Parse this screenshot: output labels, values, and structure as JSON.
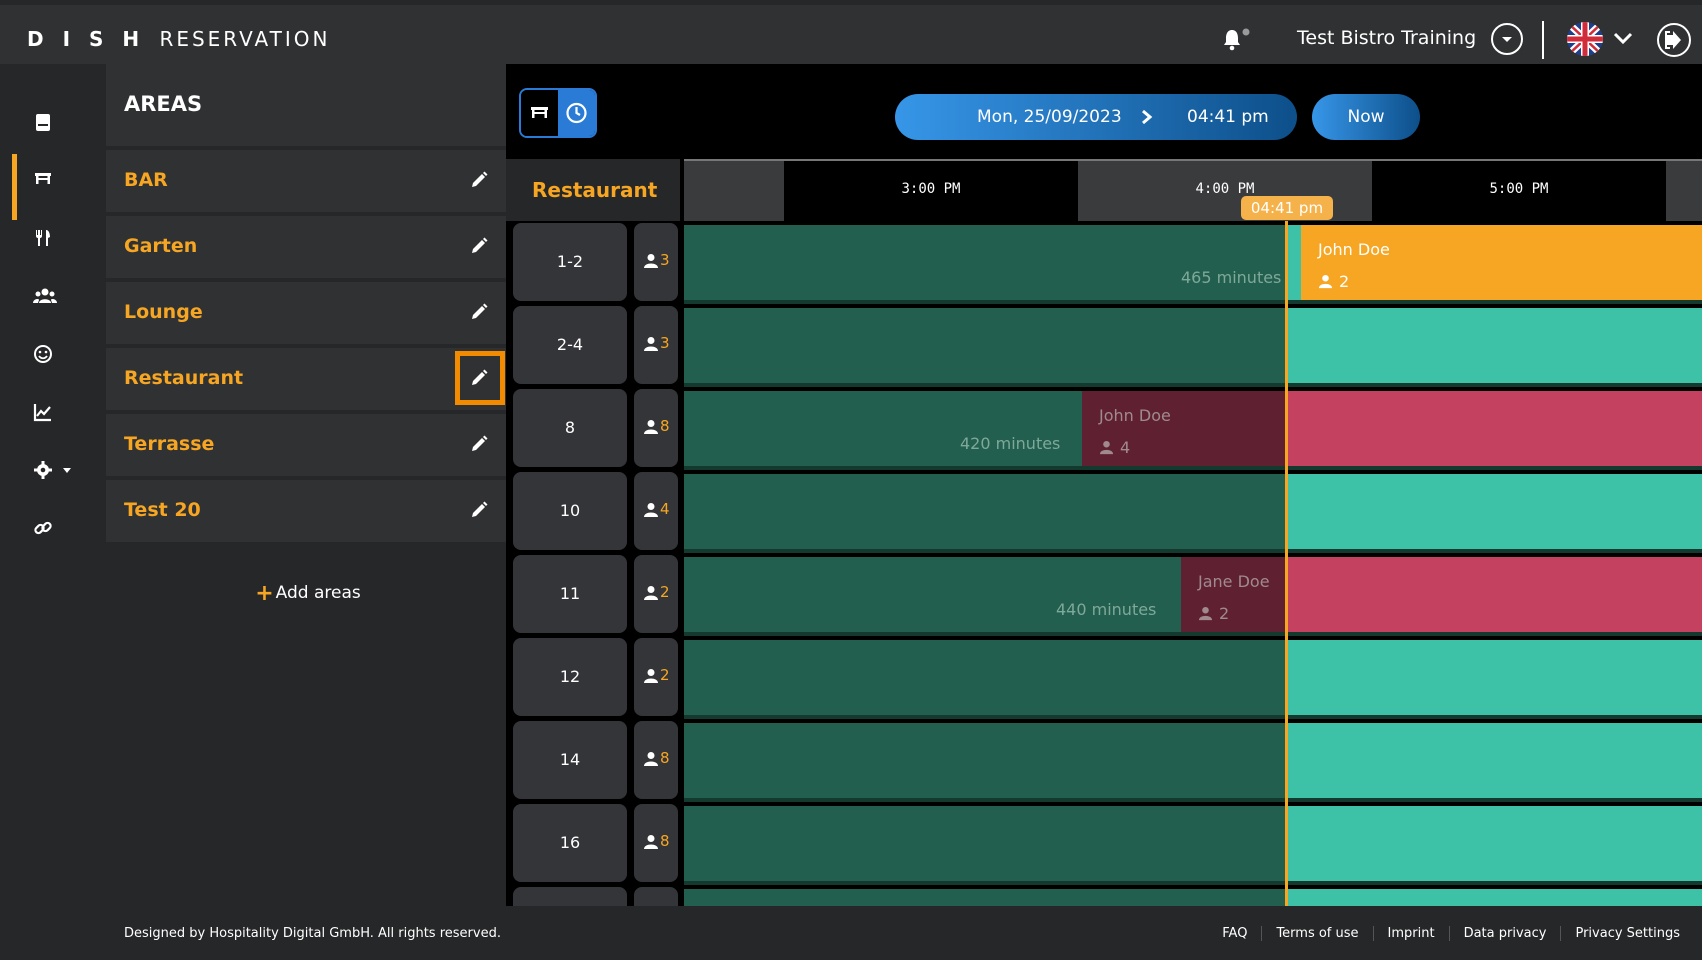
{
  "header": {
    "brand_bold": "D I S H",
    "brand_rest": "RESERVATION",
    "restaurant_name": "Test Bistro Training",
    "language_flag": "uk-flag-icon"
  },
  "sidebar": {
    "items": [
      {
        "name": "reservations-book-icon"
      },
      {
        "name": "tables-icon",
        "active": true
      },
      {
        "name": "menu-cutlery-icon"
      },
      {
        "name": "guests-icon"
      },
      {
        "name": "feedback-smiley-icon"
      },
      {
        "name": "statistics-chart-icon"
      },
      {
        "name": "settings-gear-icon"
      },
      {
        "name": "integrations-link-icon"
      }
    ]
  },
  "areas": {
    "title": "AREAS",
    "items": [
      {
        "label": "BAR"
      },
      {
        "label": "Garten"
      },
      {
        "label": "Lounge"
      },
      {
        "label": "Restaurant",
        "highlighted": true
      },
      {
        "label": "Terrasse"
      },
      {
        "label": "Test 20"
      }
    ],
    "add_label": "Add areas"
  },
  "toolbar": {
    "date": "Mon, 25/09/2023",
    "time": "04:41 pm",
    "now_label": "Now"
  },
  "timeline": {
    "area_label": "Restaurant",
    "hours": [
      "3:00 PM",
      "4:00 PM",
      "5:00 PM"
    ],
    "current_time_tag": "04:41 pm"
  },
  "tables": [
    {
      "number": "1-2",
      "capacity": "3",
      "minutes": "465 minutes",
      "reservation": {
        "name": "John Doe",
        "guests": "2",
        "status": "orange"
      }
    },
    {
      "number": "2-4",
      "capacity": "3"
    },
    {
      "number": "8",
      "capacity": "8",
      "minutes": "420 minutes",
      "reservation": {
        "name": "John Doe",
        "guests": "4",
        "status": "red"
      }
    },
    {
      "number": "10",
      "capacity": "4"
    },
    {
      "number": "11",
      "capacity": "2",
      "minutes": "440 minutes",
      "reservation": {
        "name": "Jane Doe",
        "guests": "2",
        "status": "red"
      }
    },
    {
      "number": "12",
      "capacity": "2"
    },
    {
      "number": "14",
      "capacity": "8"
    },
    {
      "number": "16",
      "capacity": "8"
    }
  ],
  "footer": {
    "copyright": "Designed by Hospitality Digital GmbH. All rights reserved.",
    "links": [
      "FAQ",
      "Terms of use",
      "Imprint",
      "Data privacy",
      "Privacy Settings"
    ]
  },
  "colors": {
    "accent": "#f6a623",
    "past_slot": "#235f4e",
    "free_slot": "#3ec2a7",
    "reserved_red_future": "#c4415f",
    "reserved_red_past": "#5f2131",
    "reserved_orange": "#f6a623"
  }
}
